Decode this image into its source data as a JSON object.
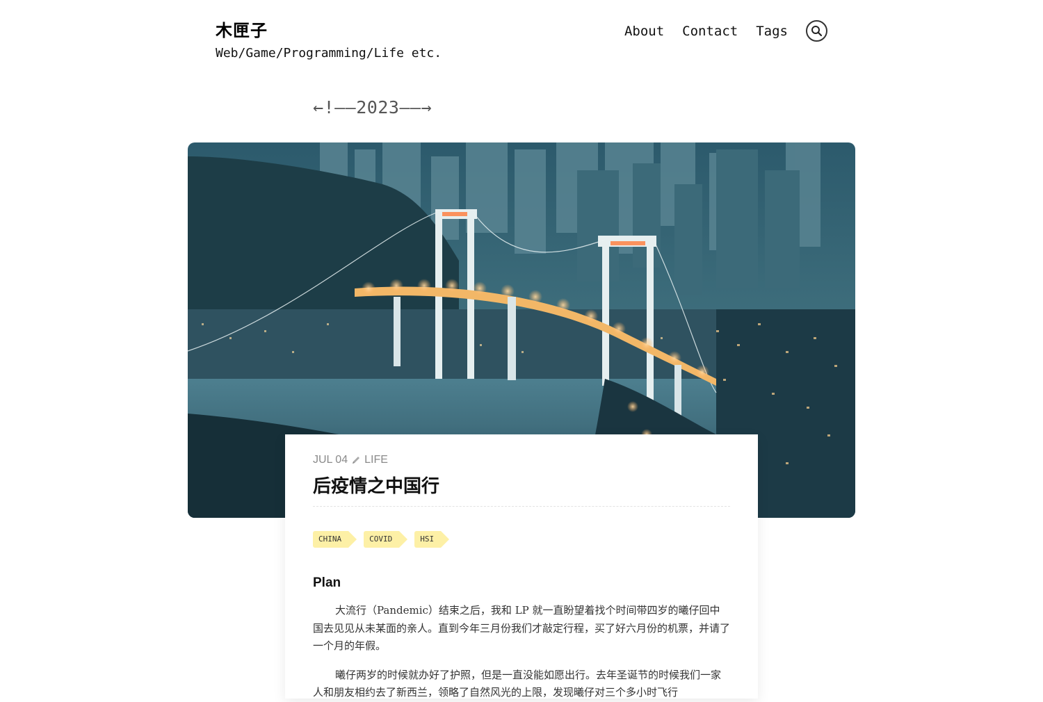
{
  "site": {
    "title": "木匣子",
    "tagline": "Web/Game/Programming/Life etc."
  },
  "nav": {
    "items": [
      {
        "label": "About"
      },
      {
        "label": "Contact"
      },
      {
        "label": "Tags"
      }
    ],
    "search_icon": "search-icon"
  },
  "year_nav": {
    "left": "←!——",
    "year": "2023",
    "right": "——→"
  },
  "hero": {
    "description_icon": "cover-photo"
  },
  "post": {
    "date": "JUL 04",
    "category": "LIFE",
    "category_icon": "pencil-icon",
    "title": "后疫情之中国行",
    "tags": [
      "CHINA",
      "COVID",
      "HSI"
    ],
    "section_heading": "Plan",
    "paragraphs": [
      "大流行（Pandemic）结束之后，我和 LP 就一直盼望着找个时间带四岁的曦仔回中国去见见从未某面的亲人。直到今年三月份我们才敲定行程，买了好六月份的机票，并请了一个月的年假。",
      "曦仔两岁的时候就办好了护照，但是一直没能如愿出行。去年圣诞节的时候我们一家人和朋友相约去了新西兰，领略了自然风光的上限，发现曦仔对三个多小时飞行"
    ]
  },
  "colors": {
    "tag_bg": "#fdf0a6",
    "meta_gray": "#8a8a8a"
  }
}
